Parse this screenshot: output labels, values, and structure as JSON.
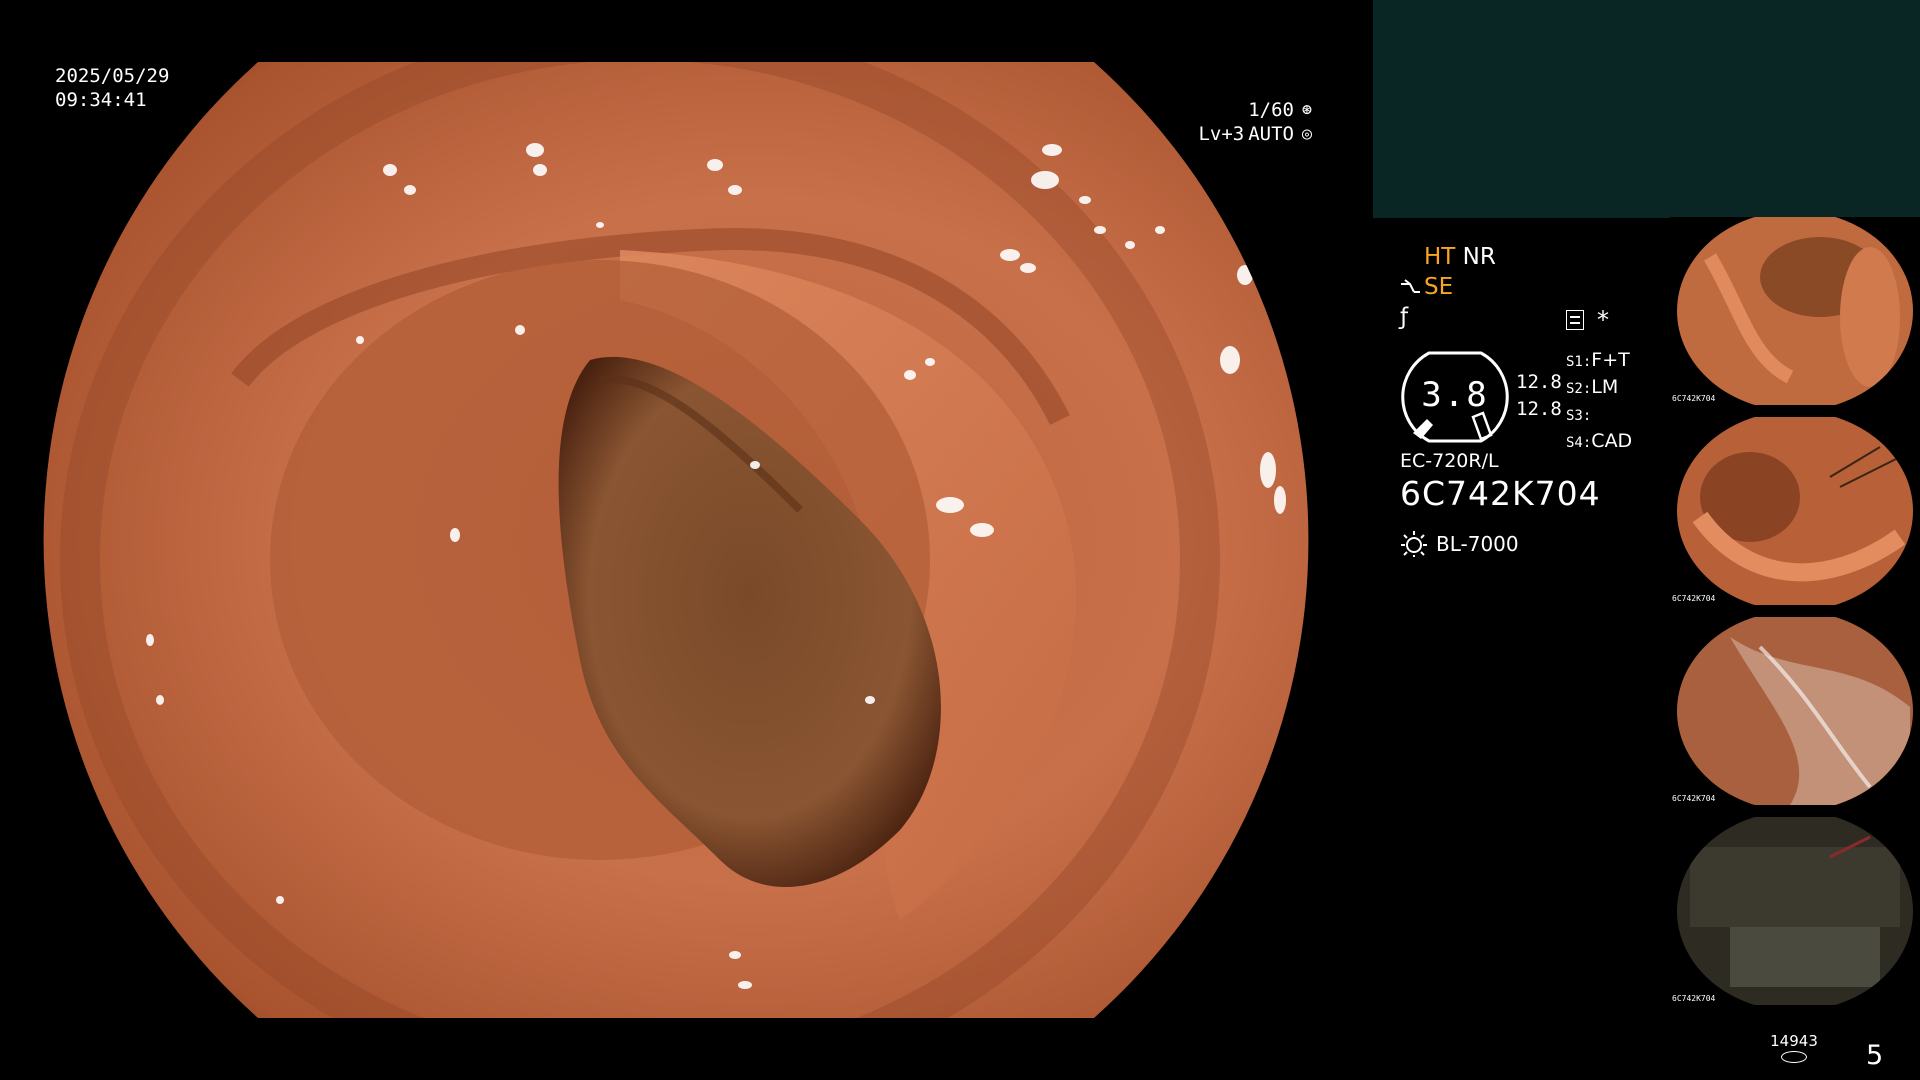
{
  "scope": {
    "date": "2025/05/29",
    "time": "09:34:41",
    "shutter": "1/60",
    "level": "Lv+3",
    "mode": "AUTO"
  },
  "panel": {
    "ht": "HT",
    "nr": "NR",
    "se": "SE",
    "iris_value": "3.8",
    "value_a": "12.8",
    "value_b": "12.8",
    "slots": [
      {
        "key": "S1:",
        "value": "F+T"
      },
      {
        "key": "S2:",
        "value": "LM"
      },
      {
        "key": "S3:",
        "value": ""
      },
      {
        "key": "S4:",
        "value": "CAD"
      }
    ],
    "scope_model": "EC-720R/L",
    "serial": "6C742K704",
    "light_source": "BL-7000"
  },
  "thumbnails": [
    {
      "serial": "6C742K704"
    },
    {
      "serial": "6C742K704"
    },
    {
      "serial": "6C742K704"
    },
    {
      "serial": "6C742K704"
    }
  ],
  "footer": {
    "counter": "14943",
    "page": "5"
  },
  "colors": {
    "orange_label": "#f6a623",
    "panel_top": "#0a2624"
  },
  "icons": [
    "shutter-icon",
    "auto-exposure-icon",
    "scope-tip-icon",
    "freeze-icon",
    "menu-box-icon",
    "star-icon",
    "light-icon",
    "disk-icon"
  ]
}
